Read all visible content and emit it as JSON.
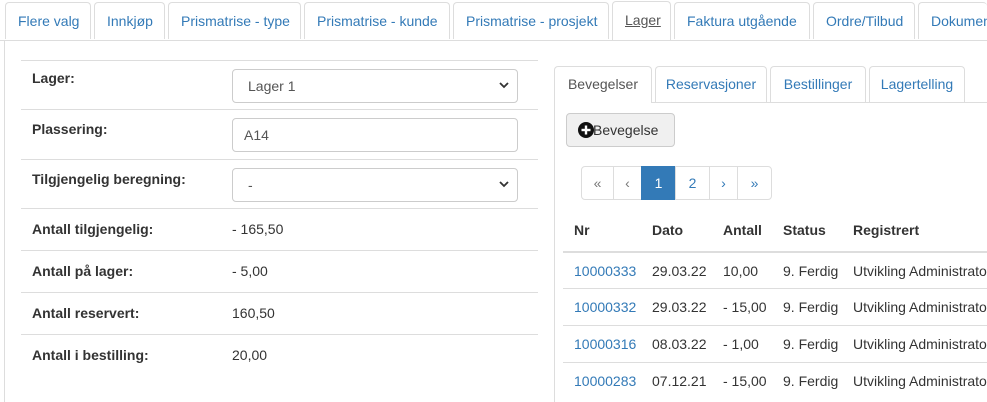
{
  "top_tabs": [
    {
      "label": "Flere valg",
      "active": false
    },
    {
      "label": "Innkjøp",
      "active": false
    },
    {
      "label": "Prismatrise - type",
      "active": false
    },
    {
      "label": "Prismatrise - kunde",
      "active": false
    },
    {
      "label": "Prismatrise - prosjekt",
      "active": false
    },
    {
      "label": "Lager",
      "active": true
    },
    {
      "label": "Faktura utgående",
      "active": false
    },
    {
      "label": "Ordre/Tilbud",
      "active": false
    },
    {
      "label": "Dokumenter",
      "active": false
    }
  ],
  "form": {
    "lager": {
      "label": "Lager:",
      "value": "Lager 1"
    },
    "plassering": {
      "label": "Plassering:",
      "value": "A14"
    },
    "tilgjengelig_beregning": {
      "label": "Tilgjengelig beregning:",
      "value": "-"
    },
    "antall_tilgjengelig": {
      "label": "Antall tilgjengelig:",
      "value": "- 165,50"
    },
    "antall_pa_lager": {
      "label": "Antall på lager:",
      "value": "- 5,00"
    },
    "antall_reservert": {
      "label": "Antall reservert:",
      "value": "160,50"
    },
    "antall_i_bestilling": {
      "label": "Antall i bestilling:",
      "value": "20,00"
    }
  },
  "sub_tabs": [
    {
      "label": "Bevegelser",
      "active": true
    },
    {
      "label": "Reservasjoner",
      "active": false
    },
    {
      "label": "Bestillinger",
      "active": false
    },
    {
      "label": "Lagertelling",
      "active": false
    }
  ],
  "add_button": {
    "label": "Bevegelse",
    "icon": "plus-circle-icon"
  },
  "pagination": {
    "first": "«",
    "prev": "‹",
    "pages": [
      "1",
      "2"
    ],
    "current": "1",
    "next": "›",
    "last": "»"
  },
  "table": {
    "columns": [
      "Nr",
      "Dato",
      "Antall",
      "Status",
      "Registrert"
    ],
    "rows": [
      {
        "nr": "10000333",
        "dato": "29.03.22",
        "antall": "10,00",
        "status": "9. Ferdig",
        "registrert": "Utvikling Administrator"
      },
      {
        "nr": "10000332",
        "dato": "29.03.22",
        "antall": "- 15,00",
        "status": "9. Ferdig",
        "registrert": "Utvikling Administrator"
      },
      {
        "nr": "10000316",
        "dato": "08.03.22",
        "antall": "- 1,00",
        "status": "9. Ferdig",
        "registrert": "Utvikling Administrator"
      },
      {
        "nr": "10000283",
        "dato": "07.12.21",
        "antall": "- 15,00",
        "status": "9. Ferdig",
        "registrert": "Utvikling Administrator"
      }
    ]
  },
  "colors": {
    "link": "#337ab7",
    "border": "#dddddd",
    "active_page": "#337ab7"
  }
}
